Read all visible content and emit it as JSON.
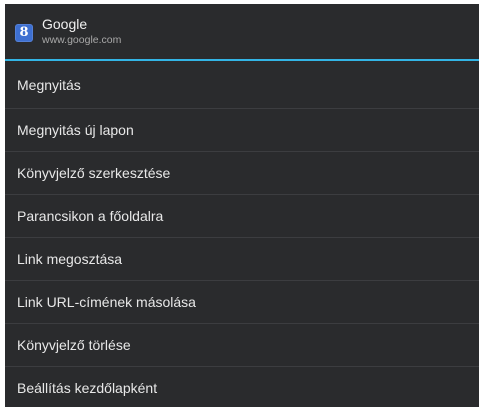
{
  "header": {
    "favicon_glyph": "8",
    "favicon_color": "#3d6fd1",
    "title": "Google",
    "url": "www.google.com"
  },
  "accent_color": "#33b5e5",
  "menu": {
    "items": [
      {
        "label": "Megnyitás"
      },
      {
        "label": "Megnyitás új lapon"
      },
      {
        "label": "Könyvjelző szerkesztése"
      },
      {
        "label": "Parancsikon a főoldalra"
      },
      {
        "label": "Link megosztása"
      },
      {
        "label": "Link URL-címének másolása"
      },
      {
        "label": "Könyvjelző törlése"
      },
      {
        "label": "Beállítás kezdőlapként"
      }
    ]
  }
}
